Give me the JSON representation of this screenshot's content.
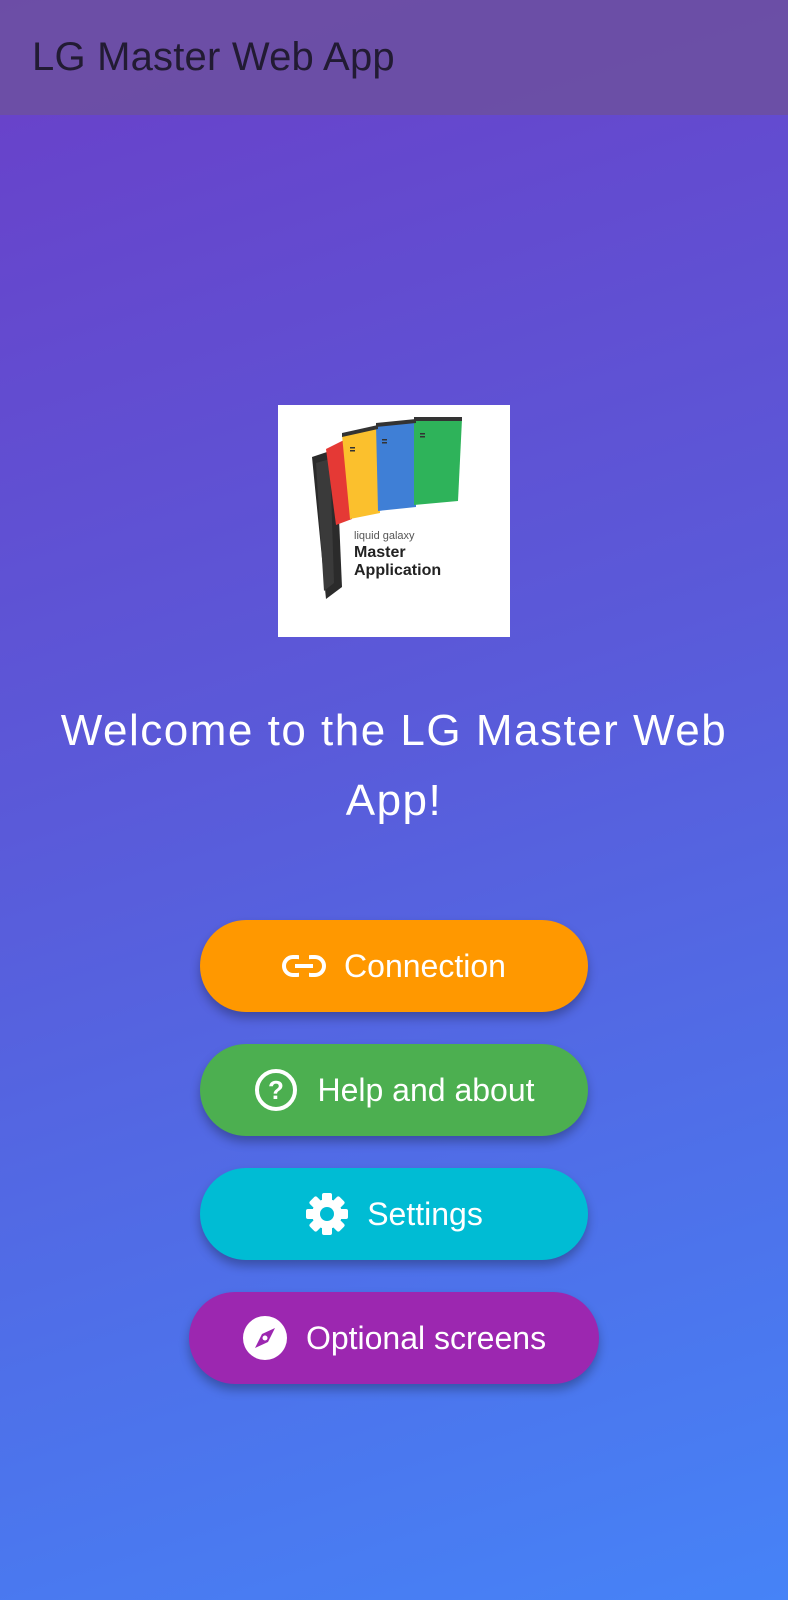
{
  "app_bar": {
    "title": "LG Master Web App"
  },
  "logo": {
    "small_text": "liquid galaxy",
    "line1": "Master",
    "line2": "Application"
  },
  "welcome": {
    "text": "Welcome to the LG Master Web App!"
  },
  "buttons": [
    {
      "label": "Connection",
      "icon": "link-icon",
      "color": "#ff9800"
    },
    {
      "label": "Help and about",
      "icon": "help-circle-icon",
      "color": "#4caf50"
    },
    {
      "label": "Settings",
      "icon": "gear-icon",
      "color": "#00bcd4"
    },
    {
      "label": "Optional screens",
      "icon": "compass-icon",
      "color": "#9c27b0"
    }
  ]
}
